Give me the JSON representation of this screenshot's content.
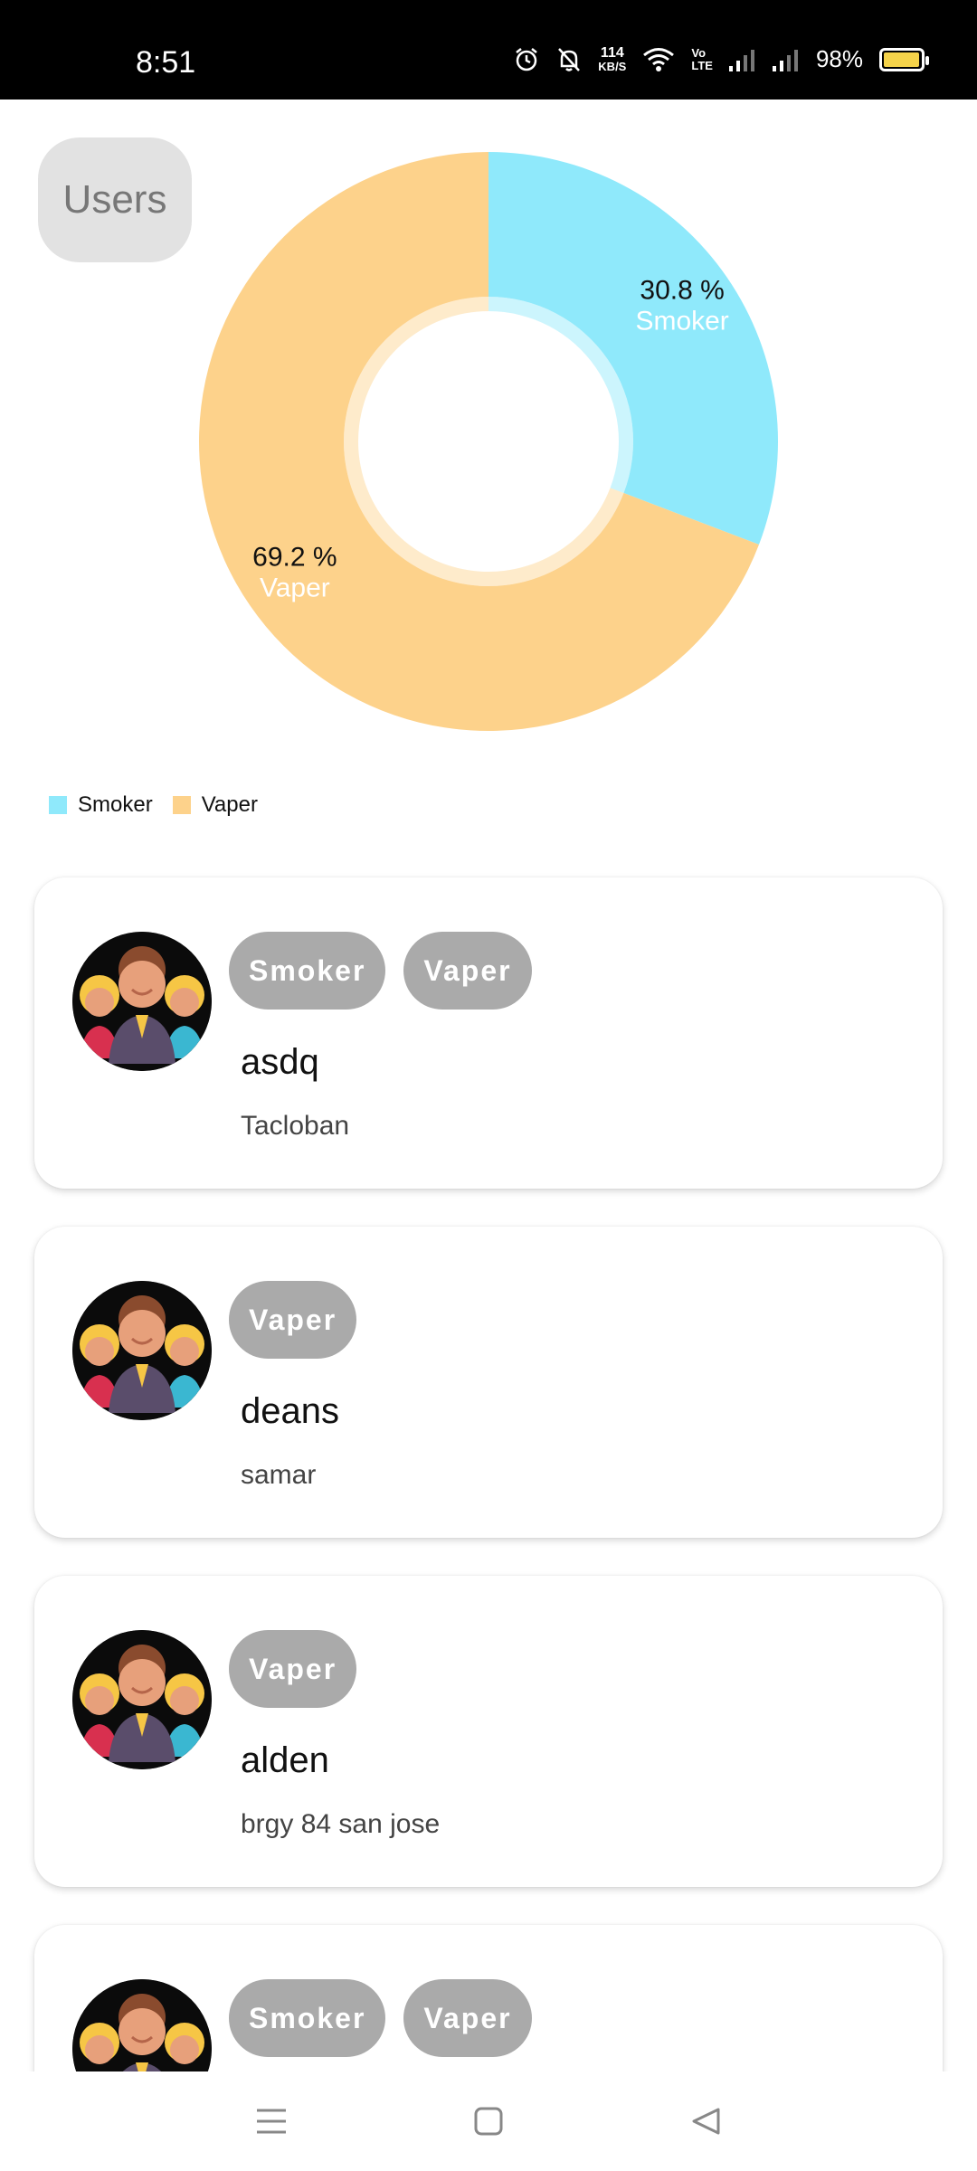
{
  "status_bar": {
    "time": "8:51",
    "net_speed_value": "114",
    "net_speed_unit": "KB/S",
    "volte_top": "Vo",
    "volte_bottom": "LTE",
    "battery_text": "98%",
    "battery_level": 0.98
  },
  "header": {
    "users_button": "Users"
  },
  "chart_data": {
    "type": "pie",
    "categories": [
      "Smoker",
      "Vaper"
    ],
    "values": [
      30.8,
      69.2
    ],
    "colors": [
      "#8fe9fb",
      "#fdd28b"
    ],
    "labels": [
      {
        "percent": "30.8 %",
        "name": "Smoker"
      },
      {
        "percent": "69.2 %",
        "name": "Vaper"
      }
    ],
    "legend": [
      "Smoker",
      "Vaper"
    ],
    "legend_placement": "bottom-left",
    "donut": true
  },
  "users": [
    {
      "tags": [
        "Smoker",
        "Vaper"
      ],
      "name": "asdq",
      "location": "Tacloban"
    },
    {
      "tags": [
        "Vaper"
      ],
      "name": "deans",
      "location": "samar"
    },
    {
      "tags": [
        "Vaper"
      ],
      "name": "alden",
      "location": "brgy 84 san jose"
    },
    {
      "tags": [
        "Smoker",
        "Vaper"
      ],
      "name": "",
      "location": ""
    }
  ],
  "icons": {
    "avatar": "group-avatar-icon",
    "nav_menu": "menu-icon",
    "nav_home": "home-square-icon",
    "nav_back": "back-triangle-icon"
  }
}
